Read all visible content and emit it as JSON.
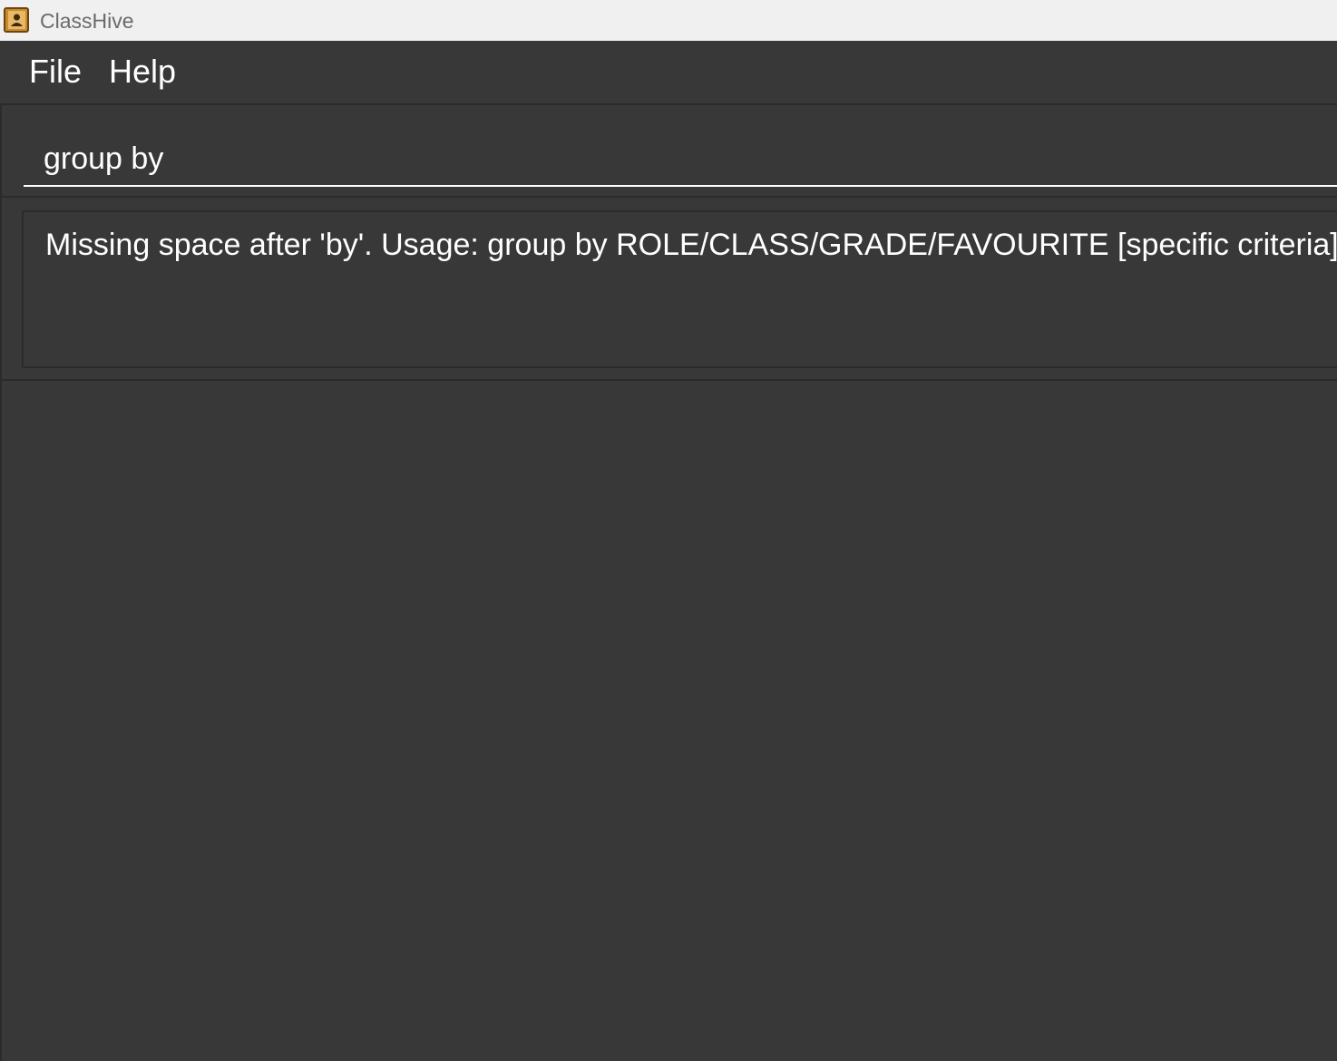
{
  "window": {
    "title": "ClassHive",
    "icon": "address-book-icon"
  },
  "menu": {
    "items": [
      {
        "label": "File"
      },
      {
        "label": "Help"
      }
    ]
  },
  "command_box": {
    "value": "group by"
  },
  "result_display": {
    "message": "Missing space after 'by'. Usage: group by ROLE/CLASS/GRADE/FAVOURITE [specific criteria]"
  },
  "person_list": {
    "items": []
  },
  "colors": {
    "background": "#383838",
    "title_bar": "#f0f0f0",
    "text": "#ffffff",
    "border": "#2b2b2b"
  }
}
